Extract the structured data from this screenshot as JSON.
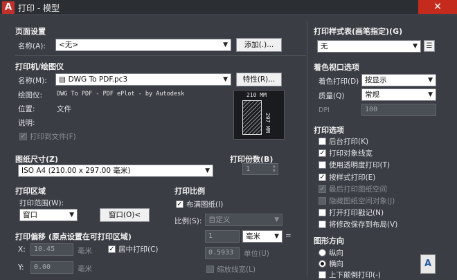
{
  "window": {
    "title": "打印 - 模型",
    "logo": "A",
    "close": "✕"
  },
  "page_setup": {
    "section": "页面设置",
    "name_label": "名称(A):",
    "name_value": "<无>",
    "add_button": "添加(.)..."
  },
  "printer": {
    "section": "打印机/绘图仪",
    "name_label": "名称(M):",
    "name_value": "DWG To PDF.pc3",
    "properties_button": "特性(R)...",
    "plotter_label": "绘图仪:",
    "plotter_value": "DWG To PDF - PDF ePlot - by Autodesk",
    "location_label": "位置:",
    "location_value": "文件",
    "description_label": "说明:",
    "print_to_file": "打印到文件(F)",
    "preview_width": "210 MM",
    "preview_height": "297 MM"
  },
  "paper_size": {
    "section": "图纸尺寸(Z)",
    "value": "ISO A4 (210.00 x 297.00 毫米)"
  },
  "copies": {
    "section": "打印份数(B)",
    "value": "1"
  },
  "plot_area": {
    "section": "打印区域",
    "range_label": "打印范围(W):",
    "range_value": "窗口",
    "window_button": "窗口(O)<"
  },
  "plot_offset": {
    "section": "打印偏移 (原点设置在可打印区域)",
    "x_label": "X:",
    "x_value": "10.45",
    "x_unit": "毫米",
    "y_label": "Y:",
    "y_value": "0.00",
    "y_unit": "毫米",
    "center_label": "居中打印(C)"
  },
  "plot_scale": {
    "section": "打印比例",
    "fit_label": "布满图纸(I)",
    "scale_label": "比例(S):",
    "scale_value": "自定义",
    "value1": "1",
    "unit": "毫米",
    "equals": "=",
    "value2": "0.5933",
    "unit2": "单位(U)",
    "lineweights_label": "缩放线宽(L)"
  },
  "plot_style_table": {
    "section": "打印样式表(画笔指定)(G)",
    "value": "无"
  },
  "shaded_viewport": {
    "section": "着色视口选项",
    "shade_label": "着色打印(D)",
    "shade_value": "按显示",
    "quality_label": "质量(Q)",
    "quality_value": "常规",
    "dpi_label": "DPI",
    "dpi_value": "100"
  },
  "plot_options": {
    "section": "打印选项",
    "items": [
      {
        "label": "后台打印(K)",
        "checked": false,
        "disabled": false
      },
      {
        "label": "打印对象线宽",
        "checked": true,
        "disabled": false
      },
      {
        "label": "使用透明度打印(T)",
        "checked": false,
        "disabled": false
      },
      {
        "label": "按样式打印(E)",
        "checked": true,
        "disabled": false
      },
      {
        "label": "最后打印图纸空间",
        "checked": true,
        "disabled": true
      },
      {
        "label": "隐藏图纸空间对象(J)",
        "checked": false,
        "disabled": true
      },
      {
        "label": "打开打印戳记(N)",
        "checked": false,
        "disabled": false
      },
      {
        "label": "将修改保存到布局(V)",
        "checked": false,
        "disabled": false
      }
    ]
  },
  "orientation": {
    "section": "图形方向",
    "portrait": "纵向",
    "landscape": "横向",
    "upside_down": "上下颠倒打印(-)",
    "icon_letter": "A"
  }
}
